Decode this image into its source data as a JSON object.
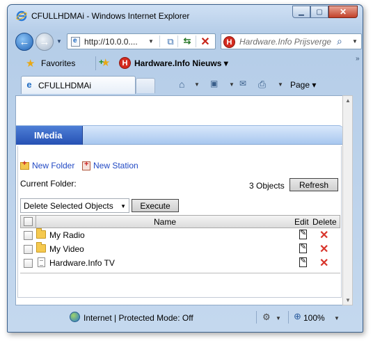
{
  "window": {
    "title": "CFULLHDMAi - Windows Internet Explorer"
  },
  "nav": {
    "address": "http://10.0.0....",
    "search_placeholder": "Hardware.Info Prijsvergelijk"
  },
  "favorites_bar": {
    "favorites_label": "Favorites",
    "hwinfo_label": "Hardware.Info Nieuws ▾",
    "hwinfo_logo": "H"
  },
  "tabs": {
    "active_tab": "CFULLHDMAi",
    "page_menu": "Page ▾"
  },
  "app": {
    "section_tab": "IMedia",
    "new_folder": "New Folder",
    "new_station": "New Station",
    "current_folder_label": "Current Folder:",
    "object_count": "3 Objects",
    "refresh": "Refresh",
    "action_select": "Delete Selected Objects",
    "execute": "Execute",
    "columns": {
      "name": "Name",
      "edit": "Edit",
      "delete": "Delete"
    },
    "rows": [
      {
        "name": "My Radio",
        "icon": "folder-icon"
      },
      {
        "name": "My Video",
        "icon": "folder-icon"
      },
      {
        "name": "Hardware.Info TV",
        "icon": "document-icon"
      }
    ]
  },
  "status": {
    "zone_text": "Internet | Protected Mode: Off",
    "zoom": "100%"
  }
}
